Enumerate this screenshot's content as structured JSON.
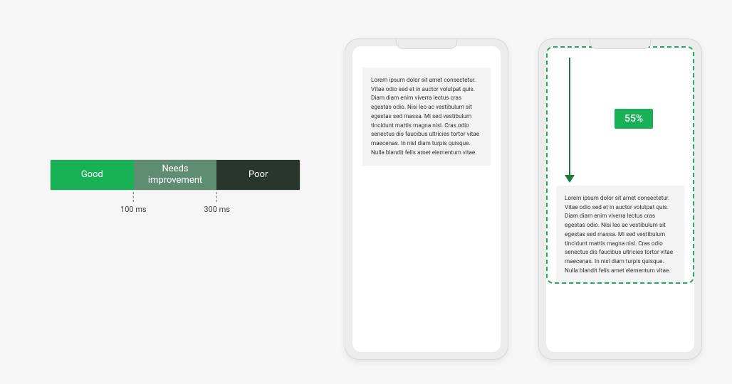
{
  "thresholds": {
    "good": {
      "label": "Good"
    },
    "needs": {
      "label": "Needs improvement"
    },
    "poor": {
      "label": "Poor"
    },
    "tick1": "100 ms",
    "tick2": "300 ms"
  },
  "phones": {
    "lorem": "Lorem ipsum dolor sit amet consectetur. Vitae odio sed et in auctor volutpat quis. Diam diam enim viverra lectus cras egestas odio. Nisi leo ac vestibulum sit egestas sed massa. Mi sed vestibulum tincidunt mattis magna nisl. Cras odio senectus dis faucibus ultricies tortor vitae maecenas. In nisl diam turpis quisque. Nulla blandit felis amet elementum vitae.",
    "shift_percent": "55%"
  },
  "colors": {
    "good": "#19b156",
    "needs": "#5f8d74",
    "poor": "#28362e",
    "accent_dark_green": "#1b7a3f"
  }
}
